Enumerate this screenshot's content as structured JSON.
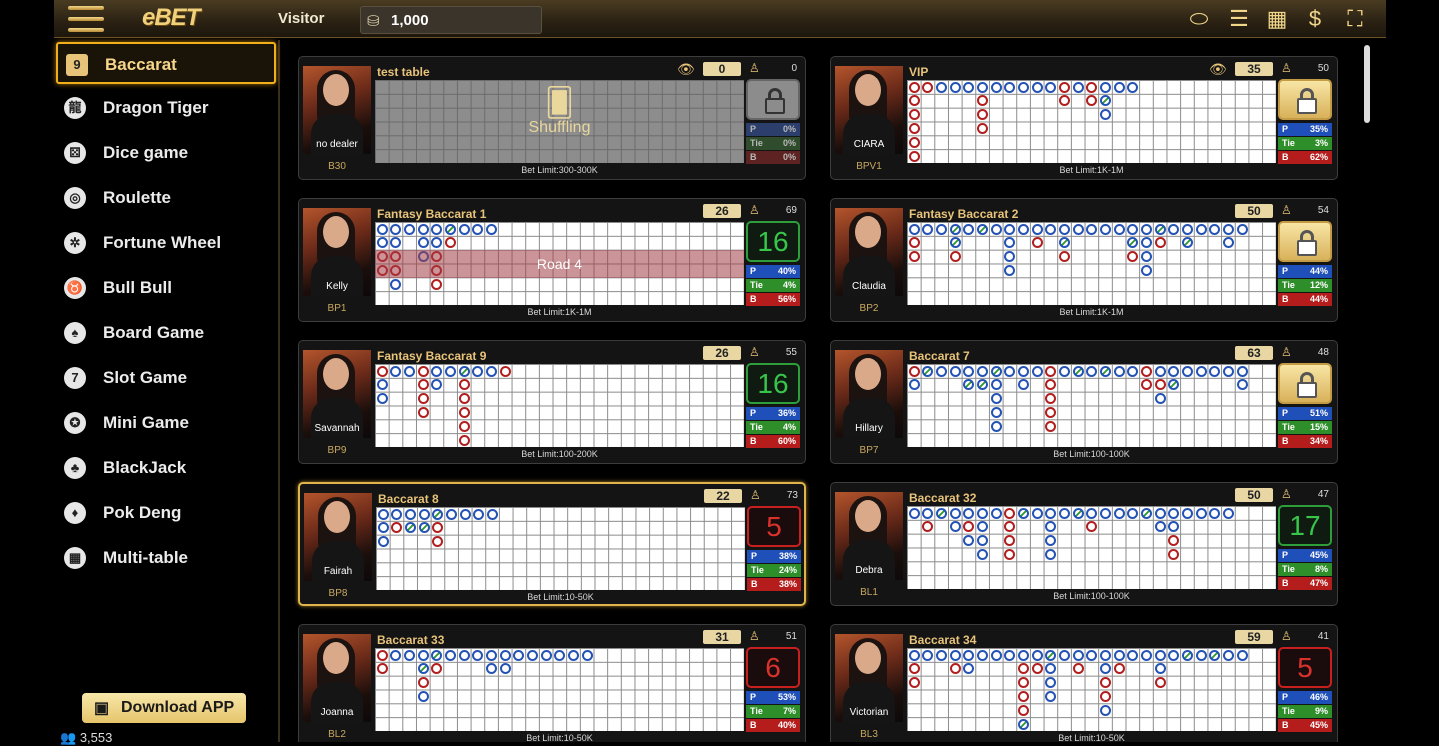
{
  "topbar": {
    "logo": "eBET",
    "visitor": "Visitor",
    "balance": "1,000"
  },
  "sidebar": {
    "items": [
      {
        "label": "Baccarat",
        "icon": "baccarat-icon",
        "glyph": "9",
        "active": true
      },
      {
        "label": "Dragon Tiger",
        "icon": "dragon-tiger-icon",
        "glyph": "龍"
      },
      {
        "label": "Dice game",
        "icon": "dice-icon",
        "glyph": "⚄"
      },
      {
        "label": "Roulette",
        "icon": "roulette-icon",
        "glyph": "◎"
      },
      {
        "label": "Fortune  Wheel",
        "icon": "fortune-wheel-icon",
        "glyph": "✲"
      },
      {
        "label": "Bull Bull",
        "icon": "bull-icon",
        "glyph": "♉"
      },
      {
        "label": "Board Game",
        "icon": "board-game-icon",
        "glyph": "♠"
      },
      {
        "label": "Slot Game",
        "icon": "slot-icon",
        "glyph": "7"
      },
      {
        "label": "Mini Game",
        "icon": "mini-game-icon",
        "glyph": "✪"
      },
      {
        "label": "BlackJack",
        "icon": "blackjack-icon",
        "glyph": "♣"
      },
      {
        "label": "Pok Deng",
        "icon": "pok-deng-icon",
        "glyph": "♦"
      },
      {
        "label": "Multi-table",
        "icon": "multi-table-icon",
        "glyph": "▦"
      }
    ],
    "download": "Download APP",
    "online": "3,553"
  },
  "tables": [
    {
      "name": "test table",
      "dealer": "no dealer",
      "code": "B30",
      "round": "0",
      "players": "0",
      "limit": "Bet Limit:300-300K",
      "status": "lock",
      "countdown": "",
      "p": "0%",
      "t": "0%",
      "b": "0%",
      "eye": true,
      "shuffling": "Shuffling",
      "dim": true,
      "beads": []
    },
    {
      "name": "VIP",
      "dealer": "CIARA",
      "code": "BPV1",
      "round": "35",
      "players": "50",
      "limit": "Bet Limit:1K-1M",
      "status": "lock",
      "countdown": "",
      "p": "35%",
      "t": "3%",
      "b": "62%",
      "eye": true,
      "beads": [
        [
          "B",
          "B",
          "B",
          "B",
          "B",
          "B"
        ],
        [
          "B"
        ],
        [
          "P"
        ],
        [
          "P"
        ],
        [
          "P"
        ],
        [
          "P",
          "B",
          "B",
          "B"
        ],
        [
          "P"
        ],
        [
          "P"
        ],
        [
          "P"
        ],
        [
          "P"
        ],
        [
          "P"
        ],
        [
          "B",
          "B"
        ],
        [
          "P"
        ],
        [
          "B",
          "B"
        ],
        [
          "P",
          "T",
          "P"
        ],
        [
          "P"
        ],
        [
          "P"
        ]
      ]
    },
    {
      "name": "Fantasy Baccarat 1",
      "dealer": "Kelly",
      "code": "BP1",
      "round": "26",
      "players": "69",
      "limit": "Bet Limit:1K-1M",
      "status": "countdown",
      "countdown": "16",
      "cdColor": "g",
      "p": "40%",
      "t": "4%",
      "b": "56%",
      "road4": "Road 4",
      "beads": [
        [
          "P",
          "P",
          "B",
          "B"
        ],
        [
          "P",
          "P",
          "B",
          "B",
          "P"
        ],
        [
          "P"
        ],
        [
          "P",
          "P",
          "P"
        ],
        [
          "P",
          "P",
          "B",
          "B",
          "B"
        ],
        [
          "T",
          "B"
        ],
        [
          "P"
        ],
        [
          "P"
        ],
        [
          "P"
        ]
      ]
    },
    {
      "name": "Fantasy Baccarat 2",
      "dealer": "Claudia",
      "code": "BP2",
      "round": "50",
      "players": "54",
      "limit": "Bet Limit:1K-1M",
      "status": "lock",
      "countdown": "",
      "p": "44%",
      "t": "12%",
      "b": "44%",
      "beads": [
        [
          "P",
          "B",
          "B"
        ],
        [
          "P"
        ],
        [
          "P"
        ],
        [
          "T",
          "T",
          "B"
        ],
        [
          "P"
        ],
        [
          "T"
        ],
        [
          "P"
        ],
        [
          "P",
          "P",
          "P",
          "P"
        ],
        [
          "P"
        ],
        [
          "P",
          "B"
        ],
        [
          "P"
        ],
        [
          "P",
          "T",
          "B"
        ],
        [
          "P"
        ],
        [
          "P"
        ],
        [
          "P"
        ],
        [
          "P"
        ],
        [
          "P",
          "T",
          "B"
        ],
        [
          "P",
          "P",
          "P",
          "P"
        ],
        [
          "T",
          "B"
        ],
        [
          "P"
        ],
        [
          "P",
          "T"
        ],
        [
          "P"
        ],
        [
          "P"
        ],
        [
          "P",
          "P"
        ],
        [
          "P"
        ]
      ]
    },
    {
      "name": "Fantasy Baccarat 9",
      "dealer": "Savannah",
      "code": "BP9",
      "round": "26",
      "players": "55",
      "limit": "Bet Limit:100-200K",
      "status": "countdown",
      "countdown": "16",
      "cdColor": "g",
      "p": "36%",
      "t": "4%",
      "b": "60%",
      "beads": [
        [
          "B",
          "P",
          "P"
        ],
        [
          "P"
        ],
        [
          "P"
        ],
        [
          "B",
          "B",
          "B",
          "B"
        ],
        [
          "P",
          "P"
        ],
        [
          "P"
        ],
        [
          "T",
          "B",
          "B",
          "B",
          "B",
          "B"
        ],
        [
          "P"
        ],
        [
          "P"
        ],
        [
          "B"
        ]
      ]
    },
    {
      "name": "Baccarat 7",
      "dealer": "Hillary",
      "code": "BP7",
      "round": "63",
      "players": "48",
      "limit": "Bet Limit:100-100K",
      "status": "lock",
      "countdown": "",
      "p": "51%",
      "t": "15%",
      "b": "34%",
      "beads": [
        [
          "B",
          "P"
        ],
        [
          "T"
        ],
        [
          "P"
        ],
        [
          "P"
        ],
        [
          "P",
          "T"
        ],
        [
          "P",
          "T"
        ],
        [
          "T",
          "P",
          "P",
          "P",
          "P"
        ],
        [
          "P"
        ],
        [
          "P",
          "P"
        ],
        [
          "P"
        ],
        [
          "B",
          "B",
          "B",
          "B",
          "B"
        ],
        [
          "P"
        ],
        [
          "T"
        ],
        [
          "P"
        ],
        [
          "T"
        ],
        [
          "P"
        ],
        [
          "P"
        ],
        [
          "B",
          "B"
        ],
        [
          "P",
          "B",
          "P"
        ],
        [
          "P",
          "T"
        ],
        [
          "P"
        ],
        [
          "P"
        ],
        [
          "P"
        ],
        [
          "P"
        ],
        [
          "P",
          "P"
        ]
      ]
    },
    {
      "name": "Baccarat 8",
      "dealer": "Fairah",
      "code": "BP8",
      "round": "22",
      "players": "73",
      "limit": "Bet Limit:10-50K",
      "status": "countdown",
      "countdown": "5",
      "cdColor": "r",
      "selected": true,
      "p": "38%",
      "t": "24%",
      "b": "38%",
      "beads": [
        [
          "P",
          "P",
          "P"
        ],
        [
          "P",
          "B"
        ],
        [
          "P",
          "T"
        ],
        [
          "P",
          "T"
        ],
        [
          "T",
          "B",
          "B"
        ],
        [
          "P"
        ],
        [
          "P"
        ],
        [
          "P"
        ],
        [
          "P"
        ]
      ]
    },
    {
      "name": "Baccarat 32",
      "dealer": "Debra",
      "code": "BL1",
      "round": "50",
      "players": "47",
      "limit": "Bet Limit:100-100K",
      "status": "countdown",
      "countdown": "17",
      "cdColor": "g",
      "p": "45%",
      "t": "8%",
      "b": "47%",
      "beads": [
        [
          "P"
        ],
        [
          "P",
          "B"
        ],
        [
          "T"
        ],
        [
          "P",
          "P"
        ],
        [
          "P",
          "B",
          "P"
        ],
        [
          "P",
          "P",
          "P",
          "P"
        ],
        [
          "P"
        ],
        [
          "B",
          "B",
          "B",
          "B"
        ],
        [
          "T"
        ],
        [
          "P"
        ],
        [
          "P",
          "P",
          "P",
          "P"
        ],
        [
          "P"
        ],
        [
          "T"
        ],
        [
          "P",
          "B"
        ],
        [
          "P"
        ],
        [
          "P"
        ],
        [
          "P"
        ],
        [
          "T"
        ],
        [
          "P",
          "P"
        ],
        [
          "P",
          "P",
          "B",
          "B"
        ],
        [
          "P"
        ],
        [
          "P"
        ],
        [
          "P"
        ],
        [
          "P"
        ]
      ]
    },
    {
      "name": "Baccarat 33",
      "dealer": "Joanna",
      "code": "BL2",
      "round": "31",
      "players": "51",
      "limit": "Bet Limit:10-50K",
      "status": "countdown",
      "countdown": "6",
      "cdColor": "r",
      "p": "53%",
      "t": "7%",
      "b": "40%",
      "beads": [
        [
          "B",
          "B"
        ],
        [
          "P"
        ],
        [
          "P"
        ],
        [
          "P",
          "T",
          "B",
          "P"
        ],
        [
          "T",
          "B"
        ],
        [
          "P"
        ],
        [
          "P"
        ],
        [
          "P"
        ],
        [
          "P",
          "P"
        ],
        [
          "P",
          "P"
        ],
        [
          "P"
        ],
        [
          "P"
        ],
        [
          "P"
        ],
        [
          "P"
        ],
        [
          "P"
        ],
        [
          "P"
        ]
      ]
    },
    {
      "name": "Baccarat 34",
      "dealer": "Victorian",
      "code": "BL3",
      "round": "59",
      "players": "41",
      "limit": "Bet Limit:10-50K",
      "status": "countdown",
      "countdown": "5",
      "cdColor": "r",
      "p": "46%",
      "t": "9%",
      "b": "45%",
      "beads": [
        [
          "P",
          "B",
          "B"
        ],
        [
          "P"
        ],
        [
          "P"
        ],
        [
          "P",
          "B"
        ],
        [
          "P",
          "P"
        ],
        [
          "P"
        ],
        [
          "P"
        ],
        [
          "P"
        ],
        [
          "P",
          "B",
          "B",
          "B",
          "B",
          "T"
        ],
        [
          "P",
          "B"
        ],
        [
          "T",
          "P",
          "P",
          "P"
        ],
        [
          "P"
        ],
        [
          "P",
          "B"
        ],
        [
          "P"
        ],
        [
          "P",
          "P",
          "B",
          "B",
          "P"
        ],
        [
          "P",
          "B"
        ],
        [
          "P"
        ],
        [
          "P"
        ],
        [
          "P",
          "P",
          "B"
        ],
        [
          "P"
        ],
        [
          "T"
        ],
        [
          "P"
        ],
        [
          "T"
        ],
        [
          "P"
        ],
        [
          "P"
        ]
      ]
    }
  ]
}
